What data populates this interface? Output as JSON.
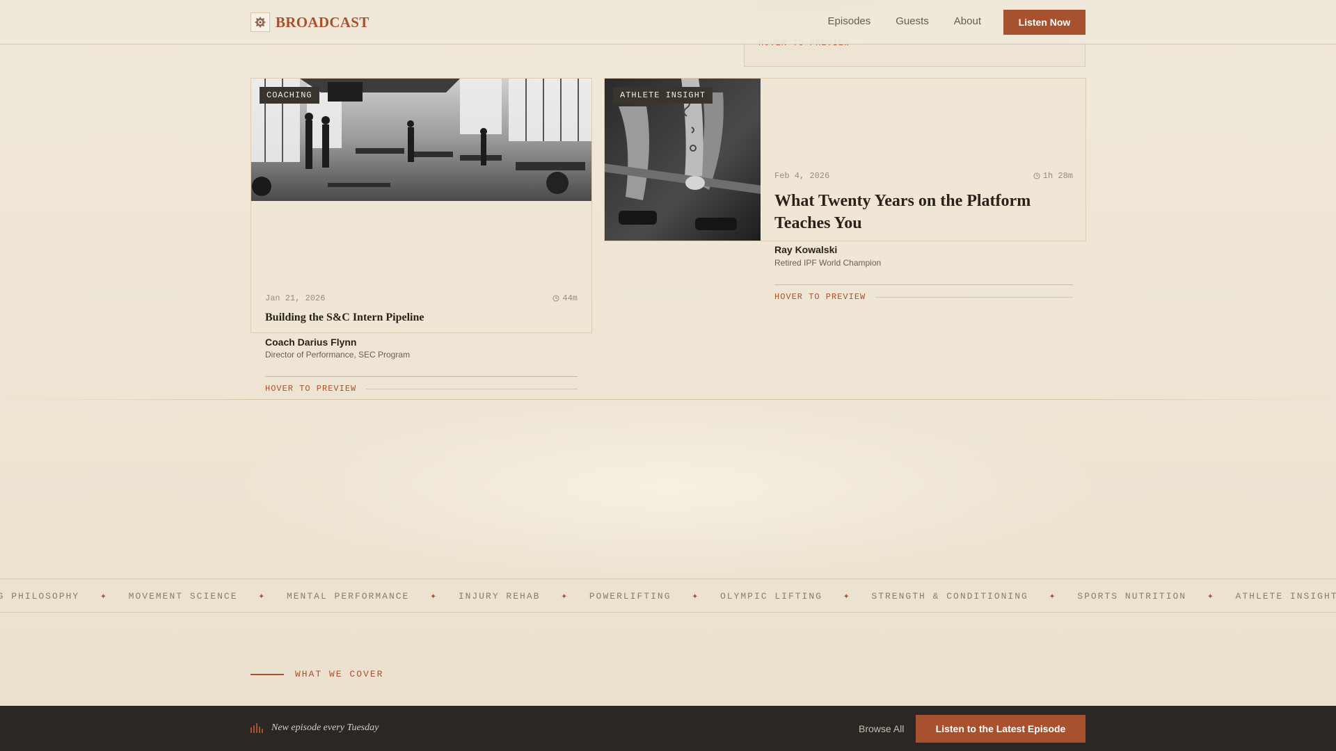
{
  "brand": {
    "name": "BROADCAST",
    "logo_icon": "lion-crest-icon"
  },
  "nav": {
    "links": [
      "Episodes",
      "Guests",
      "About"
    ],
    "cta": "Listen Now"
  },
  "ghost_card": {
    "preview_label": "HOVER TO PREVIEW"
  },
  "episodes": [
    {
      "category": "COACHING",
      "date": "Jan 21, 2026",
      "duration": "44m",
      "title": "Building the S&C Intern Pipeline",
      "guest_name": "Coach Darius Flynn",
      "guest_role": "Director of Performance, SEC Program",
      "preview_label": "HOVER TO PREVIEW",
      "image": "gym-floor-photo"
    },
    {
      "category": "ATHLETE INSIGHT",
      "date": "Feb 4, 2026",
      "duration": "1h 28m",
      "title": "What Twenty Years on the Platform Teaches You",
      "guest_name": "Ray Kowalski",
      "guest_role": "Retired IPF World Champion",
      "preview_label": "HOVER TO PREVIEW",
      "image": "barbell-deadlift-photo"
    }
  ],
  "topics_marquee": [
    "COACHING PHILOSOPHY",
    "MOVEMENT SCIENCE",
    "MENTAL PERFORMANCE",
    "INJURY REHAB",
    "POWERLIFTING",
    "OLYMPIC LIFTING",
    "STRENGTH & CONDITIONING",
    "SPORTS NUTRITION",
    "ATHLETE INSIGHT"
  ],
  "section": {
    "label": "WHAT WE COVER"
  },
  "bottom_bar": {
    "schedule": "New episode every Tuesday",
    "browse_label": "Browse All",
    "cta": "Listen to the Latest Episode"
  },
  "colors": {
    "accent": "#a8512f",
    "background": "#ede3d1",
    "dark_bar": "#2b2724",
    "badge": "#3a342f"
  }
}
